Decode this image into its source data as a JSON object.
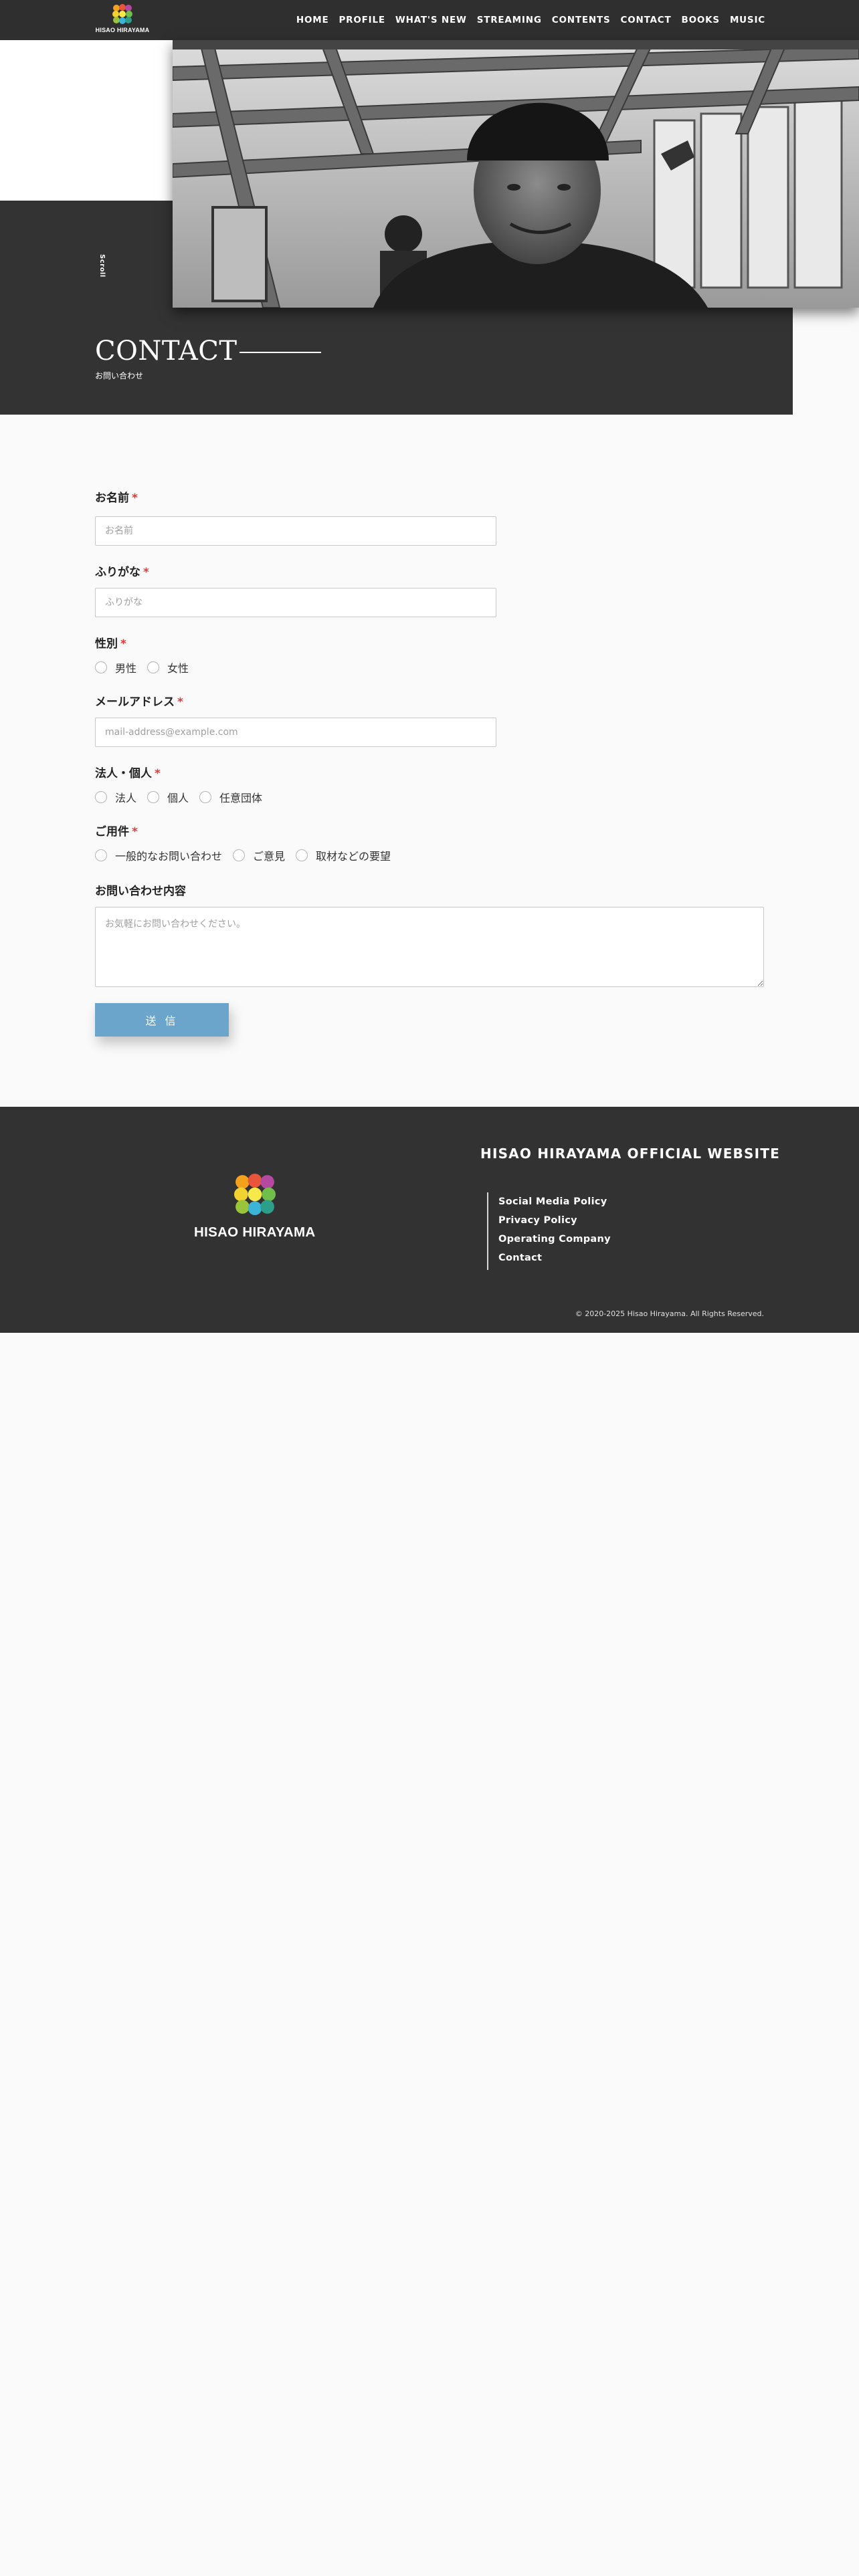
{
  "header": {
    "logo_text": "HISAO HIRAYAMA",
    "nav": [
      "HOME",
      "PROFILE",
      "WHAT'S NEW",
      "STREAMING",
      "CONTENTS",
      "CONTACT",
      "BOOKS",
      "MUSIC"
    ]
  },
  "hero": {
    "scroll_label": "Scroll",
    "title": "CONTACT",
    "subtitle": "お問い合わせ"
  },
  "form": {
    "required_mark": "*",
    "name": {
      "label": "お名前",
      "placeholder": "お名前",
      "value": ""
    },
    "furigana": {
      "label": "ふりがな",
      "placeholder": "ふりがな",
      "value": ""
    },
    "gender": {
      "label": "性別",
      "options": [
        "男性",
        "女性"
      ]
    },
    "email": {
      "label": "メールアドレス",
      "placeholder": "mail-address@example.com",
      "value": ""
    },
    "entity": {
      "label": "法人・個人",
      "options": [
        "法人",
        "個人",
        "任意団体"
      ]
    },
    "purpose": {
      "label": "ご用件",
      "options": [
        "一般的なお問い合わせ",
        "ご意見",
        "取材などの要望"
      ]
    },
    "message": {
      "label": "お問い合わせ内容",
      "placeholder": "お気軽にお問い合わせください。",
      "value": ""
    },
    "submit_label": "送 信"
  },
  "footer": {
    "logo_text": "HISAO HIRAYAMA",
    "site_title": "HISAO HIRAYAMA OFFICIAL WEBSITE",
    "links": [
      "Social Media Policy",
      "Privacy Policy",
      "Operating Company",
      "Contact"
    ],
    "copyright": "© 2020-2025 Hisao Hirayama. All Rights Reserved."
  },
  "colors": {
    "header_bg": "#2f2f2f",
    "hero_dark": "#333333",
    "required": "#e23b3b",
    "submit_button": "#6ba5cc",
    "footer_bg": "#323232"
  }
}
